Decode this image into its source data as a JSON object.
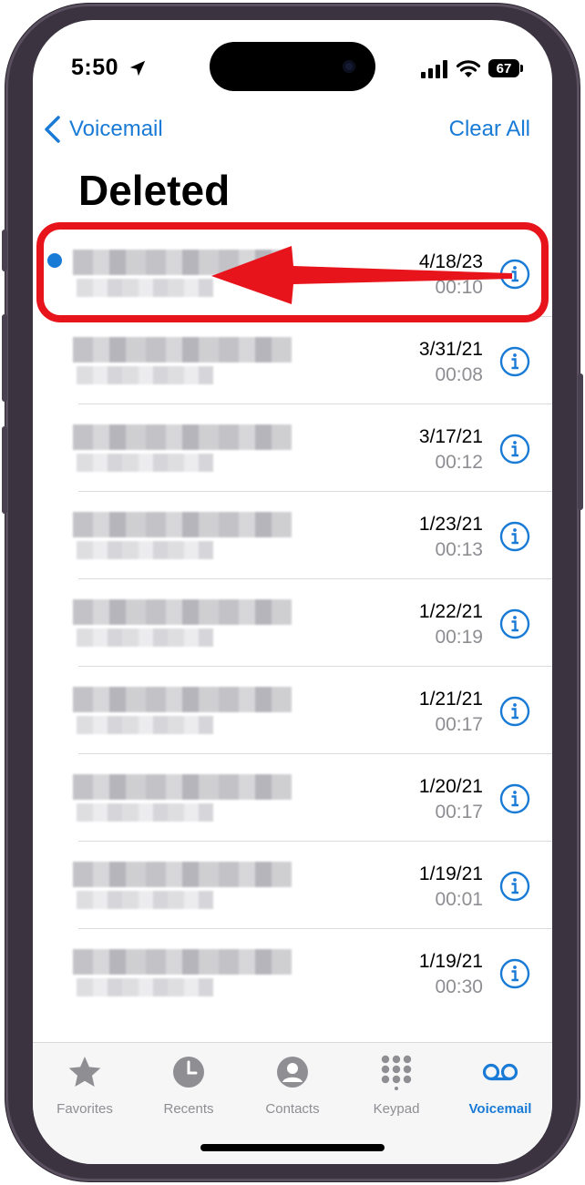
{
  "status": {
    "time": "5:50",
    "battery": "67"
  },
  "nav": {
    "back_label": "Voicemail",
    "clear_label": "Clear All"
  },
  "page": {
    "title": "Deleted"
  },
  "voicemails": [
    {
      "date": "4/18/23",
      "duration": "00:10",
      "unread": true,
      "highlighted": true
    },
    {
      "date": "3/31/21",
      "duration": "00:08"
    },
    {
      "date": "3/17/21",
      "duration": "00:12"
    },
    {
      "date": "1/23/21",
      "duration": "00:13"
    },
    {
      "date": "1/22/21",
      "duration": "00:19"
    },
    {
      "date": "1/21/21",
      "duration": "00:17"
    },
    {
      "date": "1/20/21",
      "duration": "00:17"
    },
    {
      "date": "1/19/21",
      "duration": "00:01"
    },
    {
      "date": "1/19/21",
      "duration": "00:30"
    }
  ],
  "tabs": [
    {
      "label": "Favorites",
      "icon": "star-icon",
      "active": false
    },
    {
      "label": "Recents",
      "icon": "clock-icon",
      "active": false
    },
    {
      "label": "Contacts",
      "icon": "person-icon",
      "active": false
    },
    {
      "label": "Keypad",
      "icon": "keypad-icon",
      "active": false
    },
    {
      "label": "Voicemail",
      "icon": "voicemail-icon",
      "active": true
    }
  ],
  "colors": {
    "accent": "#1a7bd6",
    "annotation": "#e8141c",
    "secondary_text": "#8e8e93"
  }
}
